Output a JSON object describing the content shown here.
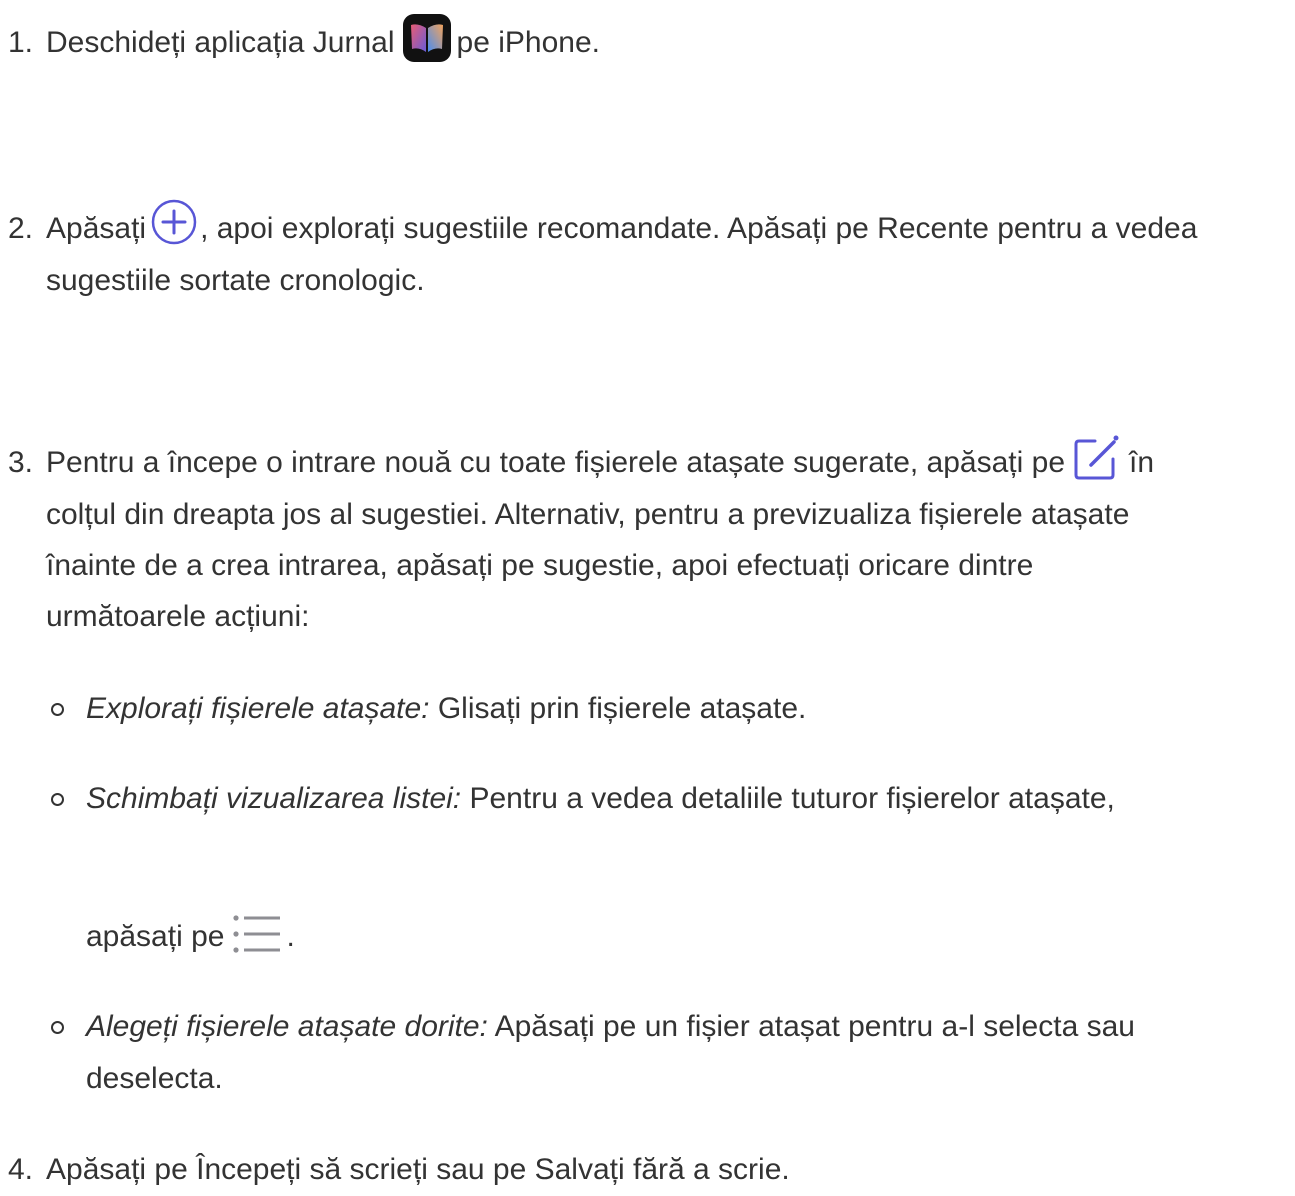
{
  "steps": [
    {
      "number": "1.",
      "text_before": "Deschideți aplicația Jurnal",
      "icon": "journal-app-icon",
      "text_after": "pe iPhone."
    },
    {
      "number": "2.",
      "text_before": "Apăsați",
      "icon": "add-circle-icon",
      "text_after": ", apoi explorați sugestiile recomandate. Apăsați pe Recente pentru a vedea",
      "line2": "sugestiile sortate cronologic."
    },
    {
      "number": "3.",
      "line1_before": "Pentru a începe o intrare nouă cu toate fișierele atașate sugerate, apăsați pe",
      "icon": "compose-icon",
      "line1_after": "în",
      "line2": "colțul din dreapta jos al sugestiei. Alternativ, pentru a previzualiza fișierele atașate",
      "line3": "înainte de a crea intrarea, apăsați pe sugestie, apoi efectuați oricare dintre",
      "line4": "următoarele acțiuni:"
    },
    {
      "number": "4.",
      "text": "Apăsați pe Începeți să scrieți sau pe Salvați fără a scrie."
    }
  ],
  "sub_items": [
    {
      "label": "Explorați fișierele atașate:",
      "text": " Glisați prin fișierele atașate."
    },
    {
      "label": "Schimbați vizualizarea listei:",
      "text": " Pentru a vedea detaliile tuturor fișierelor atașate,",
      "line2_before": "apăsați pe",
      "icon": "list-view-icon",
      "line2_after": "."
    },
    {
      "label": "Alegeți fișierele atașate dorite:",
      "text": " Apăsați pe un fișier atașat pentru a-l selecta sau",
      "line2": "deselecta."
    }
  ],
  "colors": {
    "text": "#333333",
    "accent": "#5856d6",
    "icon_gray": "#8e8e93"
  }
}
